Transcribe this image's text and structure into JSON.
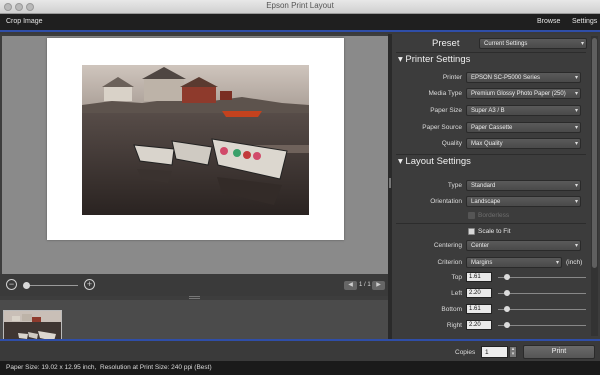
{
  "window": {
    "title": "Epson Print Layout"
  },
  "toolbar": {
    "crop_image": "Crop Image",
    "browse": "Browse",
    "settings": "Settings"
  },
  "preview": {
    "page_indicator": "1 / 1"
  },
  "preset": {
    "label": "Preset",
    "value": "Current Settings"
  },
  "printer_settings": {
    "heading": "Printer Settings",
    "rows": [
      {
        "label": "Printer",
        "value": "EPSON SC-P5000 Series"
      },
      {
        "label": "Media Type",
        "value": "Premium Glossy Photo Paper (250)"
      },
      {
        "label": "Paper Size",
        "value": "Super A3 / B"
      },
      {
        "label": "Paper Source",
        "value": "Paper Cassette"
      },
      {
        "label": "Quality",
        "value": "Max Quality"
      }
    ]
  },
  "layout_settings": {
    "heading": "Layout Settings",
    "type": {
      "label": "Type",
      "value": "Standard"
    },
    "orientation": {
      "label": "Orientation",
      "value": "Landscape"
    },
    "borderless": "Borderless",
    "scale_to_fit": "Scale to Fit",
    "centering": {
      "label": "Centering",
      "value": "Center"
    },
    "criterion": {
      "label": "Criterion",
      "value": "Margins",
      "unit": "(inch)"
    },
    "margins": [
      {
        "label": "Top",
        "value": "1.61"
      },
      {
        "label": "Left",
        "value": "2.20"
      },
      {
        "label": "Bottom",
        "value": "1.61"
      },
      {
        "label": "Right",
        "value": "2.20"
      }
    ]
  },
  "print": {
    "copies_label": "Copies",
    "copies_value": "1",
    "button": "Print"
  },
  "status": {
    "paper_size": "Paper Size: 19.02 x 12.95 inch,",
    "resolution": "Resolution at Print Size: 240 ppi (Best)"
  }
}
